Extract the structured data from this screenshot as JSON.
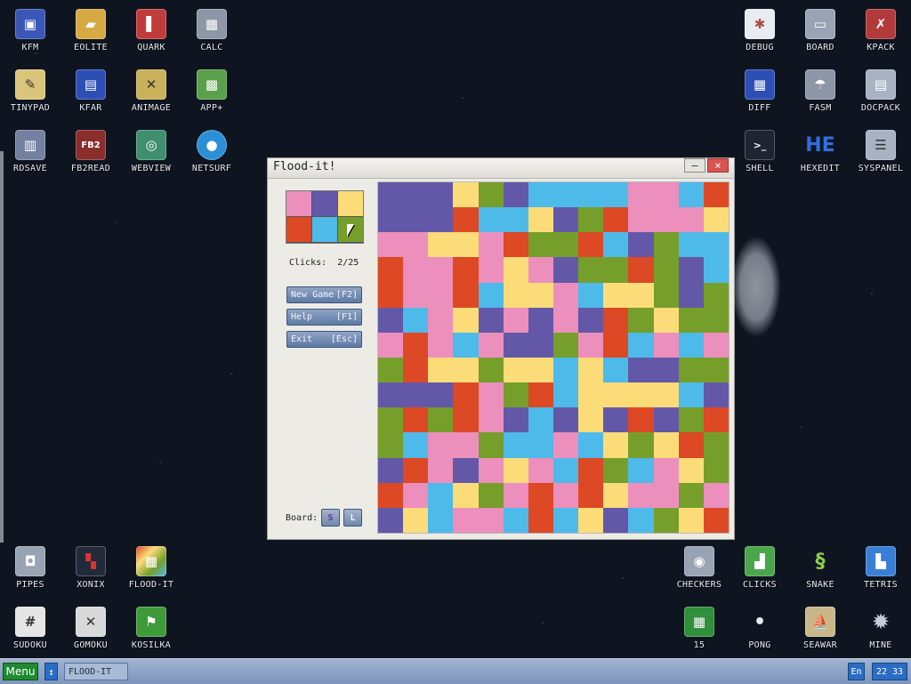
{
  "desktop_icons": {
    "kfm": {
      "label": "KFM",
      "icon": "floppy-icon",
      "glyph": "▣",
      "color": "#3a57b8"
    },
    "eolite": {
      "label": "EOLITE",
      "icon": "folder-icon",
      "glyph": "▰",
      "color": "#d7a943"
    },
    "quark": {
      "label": "QUARK",
      "icon": "book-icon",
      "glyph": "▌",
      "color": "#c23b3b"
    },
    "calc": {
      "label": "CALC",
      "icon": "calculator-icon",
      "glyph": "▦",
      "color": "#8d96a6"
    },
    "tinypad": {
      "label": "TINYPAD",
      "icon": "notepad-icon",
      "glyph": "✎",
      "color": "#d9c47a"
    },
    "kfar": {
      "label": "KFAR",
      "icon": "archive-icon",
      "glyph": "▤",
      "color": "#2d4fb5"
    },
    "animage": {
      "label": "ANIMAGE",
      "icon": "pencil-ruler-icon",
      "glyph": "✕",
      "color": "#c9b05a"
    },
    "app_plus": {
      "label": "APP+",
      "icon": "rubiks-cube-icon",
      "glyph": "▩",
      "color": "#5aa04a"
    },
    "rdsave": {
      "label": "RDSAVE",
      "icon": "disk-save-icon",
      "glyph": "▥",
      "color": "#7480a0"
    },
    "fb2read": {
      "label": "FB2READ",
      "icon": "fb2-book-icon",
      "glyph": "FB2",
      "color": "#8b2d2d"
    },
    "webview": {
      "label": "WEBVIEW",
      "icon": "globe-map-icon",
      "glyph": "◎",
      "color": "#3e8f6e"
    },
    "netsurf": {
      "label": "NETSURF",
      "icon": "planet-icon",
      "glyph": "●",
      "color": "#2c8fd6"
    },
    "debug": {
      "label": "DEBUG",
      "icon": "bug-icon",
      "glyph": "✱",
      "color": "#b24c3e"
    },
    "board": {
      "label": "BOARD",
      "icon": "board-window-icon",
      "glyph": "▭",
      "color": "#9aa3b3"
    },
    "kpack": {
      "label": "KPACK",
      "icon": "wrench-icon",
      "glyph": "✗",
      "color": "#b23a3a"
    },
    "diff": {
      "label": "DIFF",
      "icon": "diff-icon",
      "glyph": "▦",
      "color": "#2d4fb5"
    },
    "fasm": {
      "label": "FASM",
      "icon": "fasm-icon",
      "glyph": "☂",
      "color": "#8d96a6"
    },
    "docpack": {
      "label": "DOCPACK",
      "icon": "cabinet-icon",
      "glyph": "▤",
      "color": "#a7b2c3"
    },
    "shell": {
      "label": "SHELL",
      "icon": "terminal-icon",
      "glyph": ">_",
      "color": "#1e2430"
    },
    "hexedit": {
      "label": "HEXEDIT",
      "icon": "hex-icon",
      "glyph": "HE",
      "color": "#2f6fe0"
    },
    "syspanel": {
      "label": "SYSPANEL",
      "icon": "sliders-icon",
      "glyph": "☰",
      "color": "#a7b2c3"
    },
    "pipes": {
      "label": "PIPES",
      "icon": "pipes-icon",
      "glyph": "◘",
      "color": "#9aa3b3"
    },
    "xonix": {
      "label": "XONIX",
      "icon": "xonix-icon",
      "glyph": "▚",
      "color": "#222a3a"
    },
    "flood_it": {
      "label": "FLOOD-IT",
      "icon": "flood-it-icon",
      "glyph": "▦",
      "color": "#e07a6a"
    },
    "sudoku": {
      "label": "SUDOKU",
      "icon": "sudoku-icon",
      "glyph": "#",
      "color": "#e5e5e5"
    },
    "gomoku": {
      "label": "GOMOKU",
      "icon": "gomoku-icon",
      "glyph": "✕",
      "color": "#d9d9d9"
    },
    "kosilka": {
      "label": "KOSILKA",
      "icon": "lawnmower-icon",
      "glyph": "⚑",
      "color": "#3f9a3a"
    },
    "checkers": {
      "label": "CHECKERS",
      "icon": "checkers-icon",
      "glyph": "◉",
      "color": "#9aa3b3"
    },
    "clicks": {
      "label": "CLICKS",
      "icon": "clicks-icon",
      "glyph": "▟",
      "color": "#4aa64a"
    },
    "snake": {
      "label": "SNAKE",
      "icon": "snake-icon",
      "glyph": "§",
      "color": "#5aa04a"
    },
    "tetris": {
      "label": "TETRIS",
      "icon": "tetris-icon",
      "glyph": "▙",
      "color": "#3a7fd6"
    },
    "fifteen": {
      "label": "15",
      "icon": "fifteen-puzzle-icon",
      "glyph": "▦",
      "color": "#2f8f3a"
    },
    "pong": {
      "label": "PONG",
      "icon": "pong-icon",
      "glyph": "•",
      "color": "#e8ecf2"
    },
    "seawar": {
      "label": "SEAWAR",
      "icon": "ship-icon",
      "glyph": "⛵",
      "color": "#c9b78a"
    },
    "mine": {
      "label": "MINE",
      "icon": "mine-icon",
      "glyph": "✹",
      "color": "#8d96a6"
    }
  },
  "window": {
    "title": "Flood-it!",
    "minimize_glyph": "–",
    "close_glyph": "×",
    "palette": [
      "#ec8fbd",
      "#6358a8",
      "#fbdc79",
      "#dd4825",
      "#4ebaea",
      "#769e2a"
    ],
    "clicks_label": "Clicks:",
    "clicks_value": "2/25",
    "new_game_label": "New Game",
    "new_game_key": "[F2]",
    "help_label": "Help",
    "help_key": "[F1]",
    "exit_label": "Exit",
    "exit_key": "[Esc]",
    "board_label": "Board:",
    "size_small": "S",
    "size_large": "L"
  },
  "board": {
    "size": 14,
    "colors": {
      "P": "#ec8fbd",
      "V": "#6358a8",
      "Y": "#fbdc79",
      "R": "#dd4825",
      "B": "#4ebaea",
      "G": "#769e2a"
    },
    "rows": [
      "VVVYGVBBBBPPBR",
      "VVVRBBYVGRPPPY",
      "PPYYPRGGRBVGBB",
      "RPPRPYPVGGRGVB",
      "RPPRBYYPBYYGVG",
      "VBPYVPVPVRGYGG",
      "PRPBPVVGPRBPBP",
      "GRYYGYYBYBVVGG",
      "VVVRPGRBYYYYBV",
      "GRGRPVBVYVRVGR",
      "GBPPGBBPBYGYRG",
      "VRPVPYPBRGBPYG",
      "RPBYGPRPRYPPGP",
      "VYBPPBRBYVBGYR"
    ]
  },
  "taskbar": {
    "menu_label": "Menu",
    "switch_glyph": "↕",
    "task_label": "FLOOD-IT",
    "lang": "En",
    "clock": "22 33"
  }
}
